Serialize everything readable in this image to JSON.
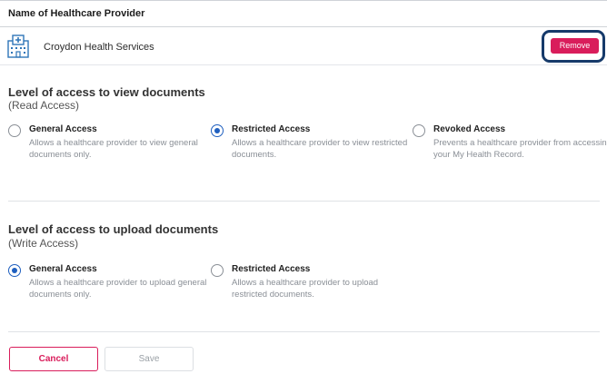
{
  "provider_header": {
    "label": "Name of Healthcare Provider"
  },
  "provider": {
    "name": "Croydon Health Services",
    "icon": "hospital-icon",
    "remove_label": "Remove"
  },
  "read_access": {
    "title": "Level of access to view documents",
    "subtitle": "(Read Access)",
    "options": [
      {
        "label": "General Access",
        "description": "Allows a healthcare provider to view general documents only.",
        "selected": false
      },
      {
        "label": "Restricted Access",
        "description": "Allows a healthcare provider to view restricted documents.",
        "selected": true
      },
      {
        "label": "Revoked Access",
        "description": "Prevents a healthcare provider from accessing your My Health Record.",
        "selected": false
      }
    ]
  },
  "write_access": {
    "title": "Level of access to upload documents",
    "subtitle": "(Write Access)",
    "options": [
      {
        "label": "General Access",
        "description": "Allows a healthcare provider to upload general documents only.",
        "selected": true
      },
      {
        "label": "Restricted Access",
        "description": "Allows a healthcare provider to upload restricted documents.",
        "selected": false
      }
    ]
  },
  "actions": {
    "cancel_label": "Cancel",
    "save_label": "Save"
  },
  "colors": {
    "accent": "#d91d5b",
    "radio_selected": "#1f5fbf",
    "highlight": "#163a6a",
    "icon": "#2f76b8"
  }
}
